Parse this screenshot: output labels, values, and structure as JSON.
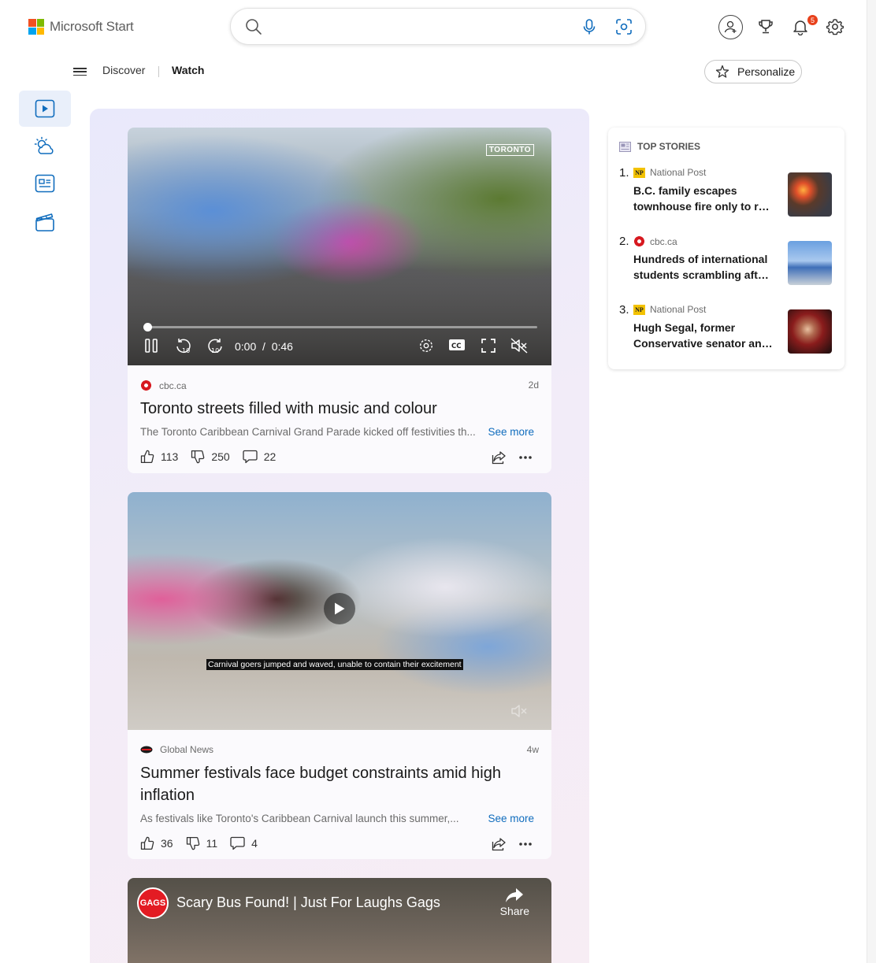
{
  "header": {
    "brand": "Microsoft Start",
    "search_placeholder": "",
    "notification_count": "5",
    "icons": [
      "search-icon",
      "microphone-icon",
      "visual-search-icon",
      "account-icon",
      "rewards-icon",
      "bell-icon",
      "gear-icon"
    ]
  },
  "nav": {
    "discover": "Discover",
    "watch": "Watch",
    "personalize": "Personalize"
  },
  "rail": {
    "items": [
      "video-icon",
      "weather-icon",
      "news-icon",
      "movie-icon"
    ],
    "active": "video-icon"
  },
  "feed": {
    "cards": [
      {
        "watermark": "TORONTO",
        "time_current": "0:00",
        "time_separator": "/",
        "time_total": "0:46",
        "progress": 0.0,
        "source": "cbc.ca",
        "age": "2d",
        "title": "Toronto streets filled with music and colour",
        "description": "The Toronto Caribbean Carnival Grand Parade kicked off festivities th...",
        "see_more": "See more",
        "likes": "113",
        "dislikes": "250",
        "comments": "22"
      },
      {
        "caption": "Carnival goers jumped and waved, unable to contain their excitement",
        "source": "Global News",
        "age": "4w",
        "title": "Summer festivals face budget constraints amid high inflation",
        "description": "As festivals like Toronto's Caribbean Carnival launch this summer,...",
        "see_more": "See more",
        "likes": "36",
        "dislikes": "11",
        "comments": "4"
      },
      {
        "channel_logo": "GAGS",
        "title": "Scary Bus Found! | Just For Laughs Gags",
        "share": "Share"
      }
    ]
  },
  "top_stories": {
    "heading": "TOP STORIES",
    "items": [
      {
        "num": "1.",
        "source": "National Post",
        "logo": "NP",
        "title": "B.C. family escapes townhouse fire only to run into a fire..."
      },
      {
        "num": "2.",
        "source": "cbc.ca",
        "logo": "cbc",
        "title": "Hundreds of international students scrambling after Ontario college..."
      },
      {
        "num": "3.",
        "source": "National Post",
        "logo": "NP",
        "title": "Hugh Segal, former Conservative senator and advisor..."
      }
    ]
  },
  "colors": {
    "accent": "#0f6cbd",
    "badge": "#e8411b",
    "rail_active_bg": "#e9effa"
  }
}
